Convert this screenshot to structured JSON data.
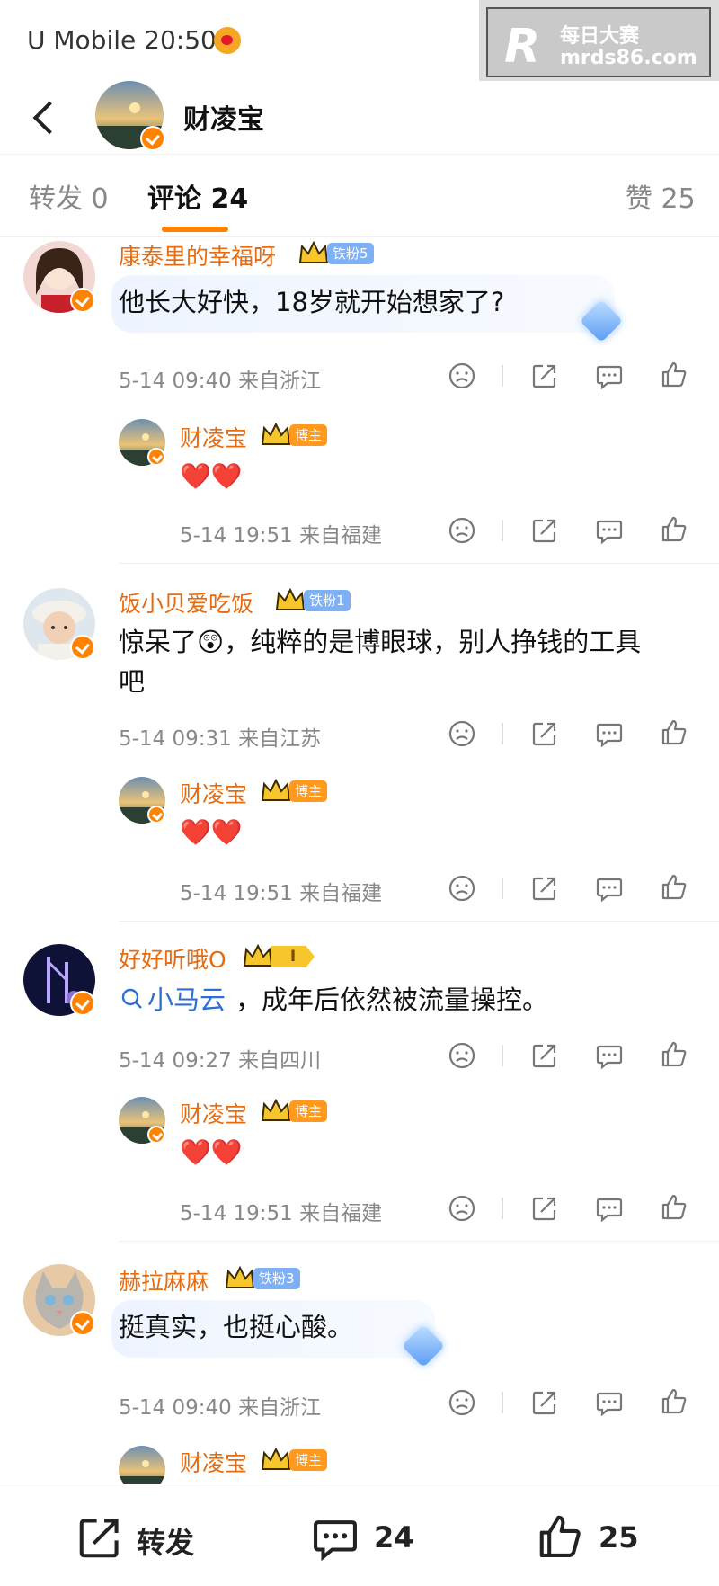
{
  "status_bar": {
    "carrier_time": "U Mobile 20:50"
  },
  "watermark": {
    "logo": "R",
    "line1": "每日大赛",
    "line2": "mrds86.com"
  },
  "header": {
    "title": "财凌宝"
  },
  "tabs": [
    {
      "label": "转发 0"
    },
    {
      "label": "评论 24"
    },
    {
      "label": "赞 25"
    }
  ],
  "colors": {
    "accent": "#ff8200",
    "username": "#e86b0f",
    "mention": "#2c6fd6",
    "fan_badge": "#7db0f5"
  },
  "comments": [
    {
      "name": "康泰里的幸福呀",
      "badge": "铁粉5",
      "text": "他长大好快，18岁就开始想家了?",
      "meta": "5-14 09:40  来自浙江",
      "reply": {
        "name": "财凌宝",
        "badge": "博主",
        "text": "❤️❤️",
        "meta": "5-14 19:51  来自福建"
      }
    },
    {
      "name": "饭小贝爱吃饭",
      "badge": "铁粉1",
      "text_line1": "惊呆了😲，纯粹的是博眼球，别人挣钱的工具",
      "text_line2": "吧",
      "meta": "5-14 09:31  来自江苏",
      "reply": {
        "name": "财凌宝",
        "badge": "博主",
        "text": "❤️❤️",
        "meta": "5-14 19:51  来自福建"
      }
    },
    {
      "name": "好好听哦O",
      "badge": "I",
      "mention": "小马云",
      "text": "，成年后依然被流量操控。",
      "meta": "5-14 09:27  来自四川",
      "reply": {
        "name": "财凌宝",
        "badge": "博主",
        "text": "❤️❤️",
        "meta": "5-14 19:51  来自福建"
      }
    },
    {
      "name": "赫拉麻麻",
      "badge": "铁粉3",
      "text": "挺真实，也挺心酸。",
      "meta": "5-14 09:40  来自浙江",
      "reply": {
        "name": "财凌宝",
        "badge": "博主"
      }
    }
  ],
  "bottom_bar": {
    "repost": "转发",
    "comments": "24",
    "likes": "25"
  },
  "icons": [
    "back-icon",
    "dislike-icon",
    "share-icon",
    "comment-icon",
    "like-icon"
  ]
}
